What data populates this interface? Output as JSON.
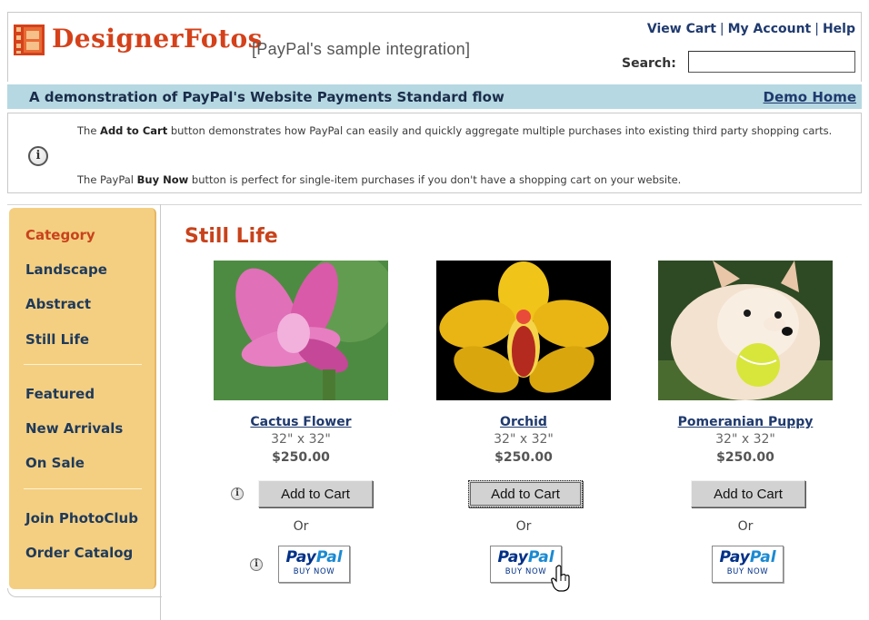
{
  "header": {
    "brand": "DesignerFotos",
    "tagline": "[PayPal's sample integration]",
    "links": [
      "View Cart",
      "My Account",
      "Help"
    ],
    "search_label": "Search:",
    "search_value": ""
  },
  "banner": {
    "title": "A demonstration of PayPal's Website Payments Standard flow",
    "demo_home": "Demo Home"
  },
  "info": {
    "p1_prefix": "The ",
    "p1_bold": "Add to Cart",
    "p1_suffix": " button demonstrates how PayPal can easily and quickly aggregate multiple purchases into existing third party shopping carts.",
    "p2_prefix": "The PayPal ",
    "p2_bold": "Buy Now",
    "p2_suffix": " button is perfect for single-item purchases if you don't have a shopping cart on your website."
  },
  "sidebar": {
    "items": [
      "Category",
      "Landscape",
      "Abstract",
      "Still Life",
      "Featured",
      "New Arrivals",
      "On Sale",
      "Join PhotoClub",
      "Order Catalog"
    ]
  },
  "main": {
    "section_title": "Still Life",
    "products": [
      {
        "name": "Cactus Flower",
        "size": "32\" x 32\"",
        "price": "$250.00",
        "add_to_cart": "Add to Cart",
        "or": "Or",
        "paypal_word_pay": "Pay",
        "paypal_word_pal": "Pal",
        "buy_now": "BUY NOW"
      },
      {
        "name": "Orchid",
        "size": "32\" x 32\"",
        "price": "$250.00",
        "add_to_cart": "Add to Cart",
        "or": "Or",
        "paypal_word_pay": "Pay",
        "paypal_word_pal": "Pal",
        "buy_now": "BUY NOW"
      },
      {
        "name": "Pomeranian Puppy",
        "size": "32\" x 32\"",
        "price": "$250.00",
        "add_to_cart": "Add to Cart",
        "or": "Or",
        "paypal_word_pay": "Pay",
        "paypal_word_pal": "Pal",
        "buy_now": "BUY NOW"
      }
    ]
  },
  "colors": {
    "brand": "#d4411a",
    "banner_bg": "#b6d8e2",
    "sidebar_bg": "#f4cf82",
    "link": "#1f3a6e",
    "paypal_dark": "#003087",
    "paypal_light": "#1a8ad2"
  },
  "icons": [
    "logo-icon",
    "info-icon",
    "hand-cursor-icon"
  ]
}
